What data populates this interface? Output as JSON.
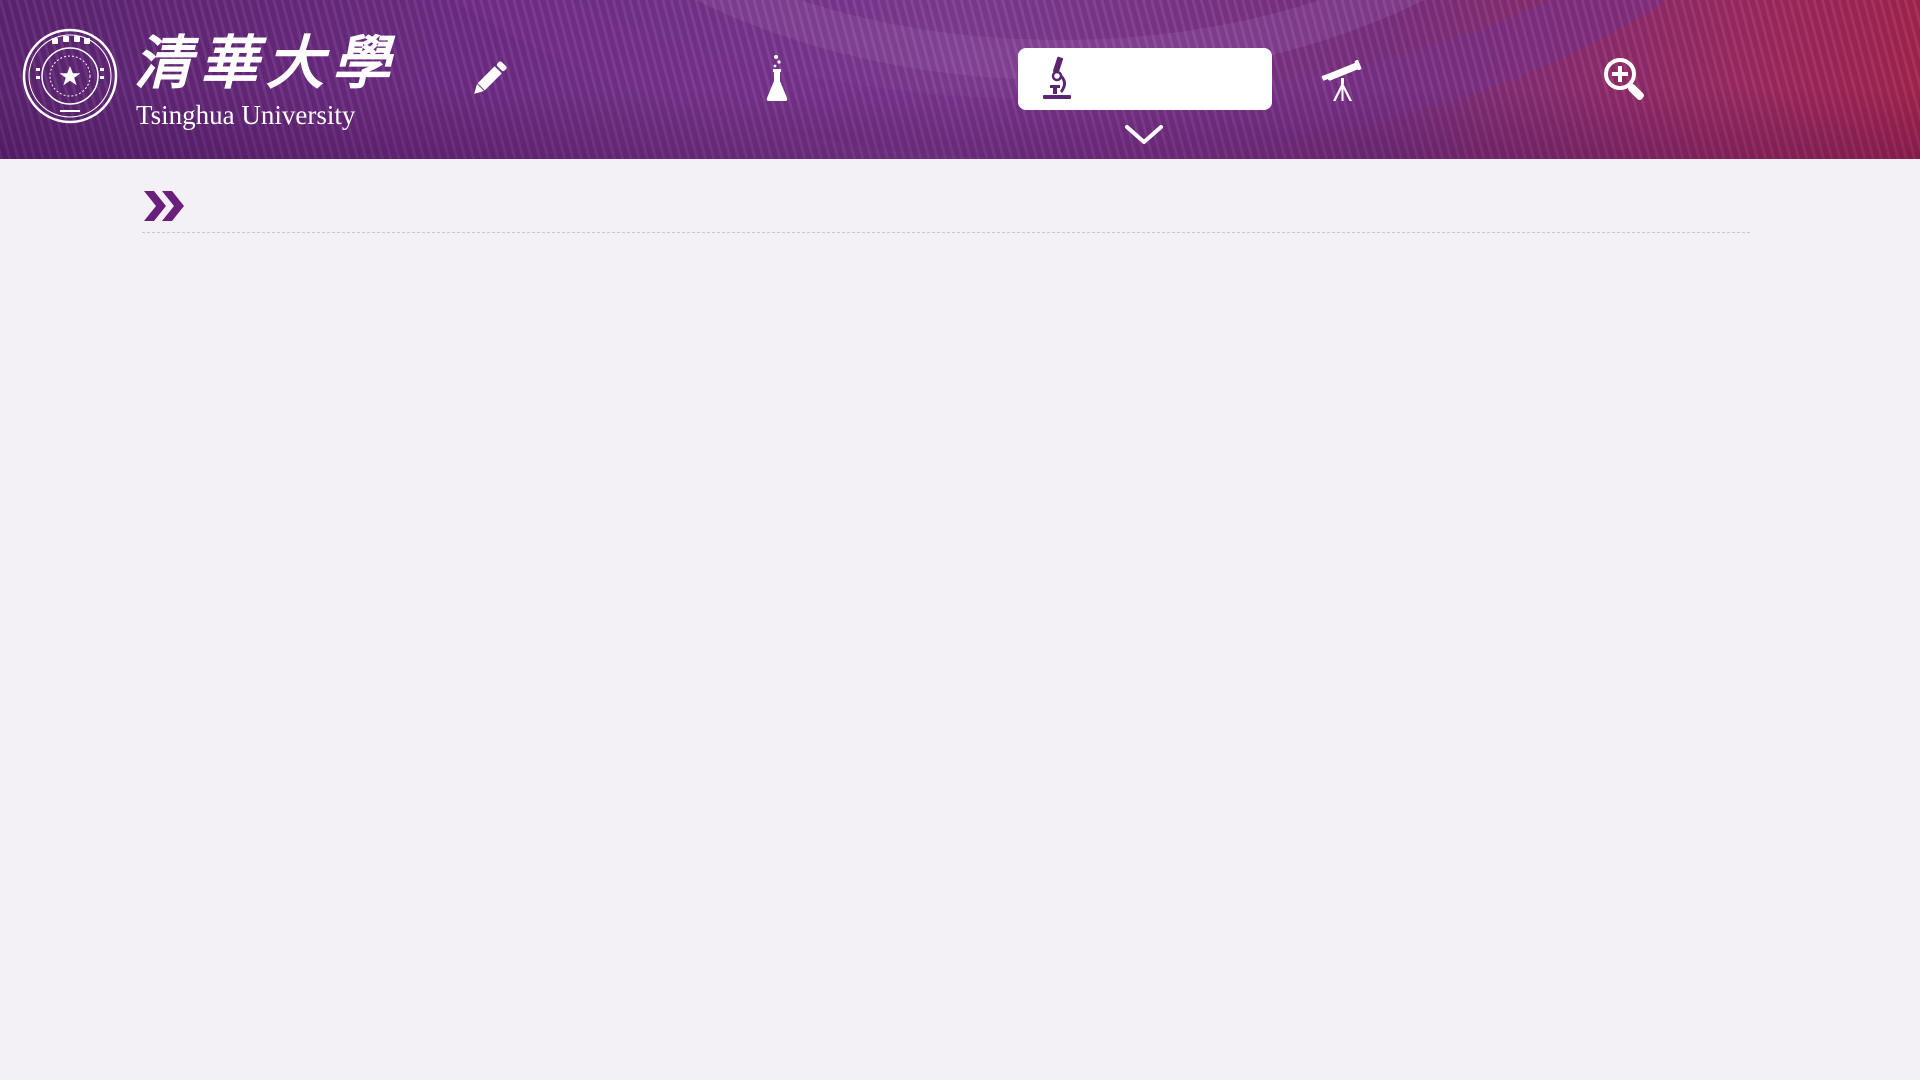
{
  "brand": {
    "name_cn": "清華大學",
    "name_en": "Tsinghua University",
    "seal_icon": "university-seal-icon"
  },
  "colors": {
    "brand_purple": "#5d2472",
    "page_background": "#f3f1f6",
    "active_tab_background": "#ffffff"
  },
  "nav": {
    "items": [
      {
        "icon": "pencil-icon",
        "label": "",
        "active": false
      },
      {
        "icon": "flask-icon",
        "label": "",
        "active": false
      },
      {
        "icon": "microscope-icon",
        "label": "",
        "active": true
      },
      {
        "icon": "telescope-icon",
        "label": "",
        "active": false
      },
      {
        "icon": "zoom-in-icon",
        "label": "",
        "active": false
      }
    ],
    "expand_icon": "chevron-down-icon"
  },
  "breadcrumb": {
    "icon": "double-chevron-right-icon",
    "text": ""
  }
}
